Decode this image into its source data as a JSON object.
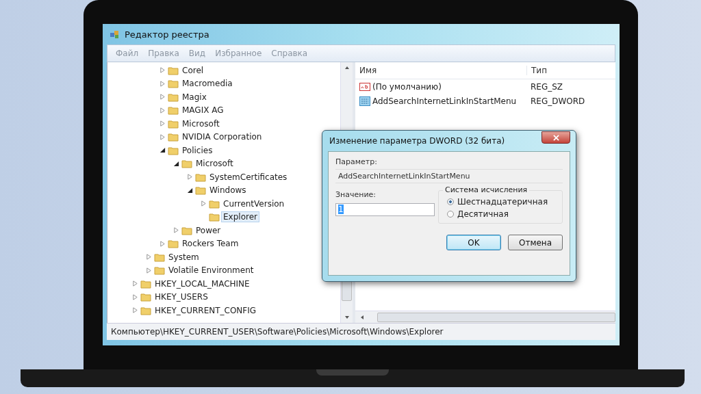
{
  "window": {
    "title": "Редактор реестра"
  },
  "menu": [
    "Файл",
    "Правка",
    "Вид",
    "Избранное",
    "Справка"
  ],
  "tree": [
    {
      "children": [
        {
          "children": [
            {
              "label": "Corel",
              "expandable": true,
              "expanded": false,
              "selected": false
            },
            {
              "label": "Macromedia",
              "expandable": true,
              "expanded": false,
              "selected": false
            },
            {
              "label": "Magix",
              "expandable": true,
              "expanded": false,
              "selected": false
            },
            {
              "label": "MAGIX AG",
              "expandable": true,
              "expanded": false,
              "selected": false
            },
            {
              "label": "Microsoft",
              "expandable": true,
              "expanded": false,
              "selected": false
            },
            {
              "label": "NVIDIA Corporation",
              "expandable": true,
              "expanded": false,
              "selected": false
            },
            {
              "label": "Policies",
              "expandable": true,
              "expanded": true,
              "selected": false,
              "children": [
                {
                  "label": "Microsoft",
                  "expandable": true,
                  "expanded": true,
                  "selected": false,
                  "children": [
                    {
                      "label": "SystemCertificates",
                      "expandable": true,
                      "expanded": false,
                      "selected": false
                    },
                    {
                      "label": "Windows",
                      "expandable": true,
                      "expanded": true,
                      "selected": false,
                      "children": [
                        {
                          "label": "CurrentVersion",
                          "expandable": true,
                          "expanded": false,
                          "selected": false
                        },
                        {
                          "label": "Explorer",
                          "expandable": false,
                          "selected": true
                        }
                      ]
                    }
                  ]
                },
                {
                  "label": "Power",
                  "expandable": true,
                  "expanded": false,
                  "selected": false
                }
              ]
            },
            {
              "label": "Rockers Team",
              "expandable": true,
              "expanded": false,
              "selected": false
            }
          ]
        },
        {
          "label": "System",
          "expandable": true,
          "expanded": false,
          "selected": false
        },
        {
          "label": "Volatile Environment",
          "expandable": true,
          "expanded": false,
          "selected": false
        }
      ]
    },
    {
      "label": "HKEY_LOCAL_MACHINE",
      "expandable": true,
      "expanded": false,
      "selected": false
    },
    {
      "label": "HKEY_USERS",
      "expandable": true,
      "expanded": false,
      "selected": false
    },
    {
      "label": "HKEY_CURRENT_CONFIG",
      "expandable": true,
      "expanded": false,
      "selected": false
    }
  ],
  "values": {
    "columns": [
      "Имя",
      "Тип"
    ],
    "rows": [
      {
        "kind": "string",
        "name": "(По умолчанию)",
        "type": "REG_SZ"
      },
      {
        "kind": "binary",
        "name": "AddSearchInternetLinkInStartMenu",
        "type": "REG_DWORD"
      }
    ]
  },
  "dialog": {
    "title": "Изменение параметра DWORD (32 бита)",
    "parameter_label": "Параметр:",
    "parameter_value": "AddSearchInternetLinkInStartMenu",
    "value_label": "Значение:",
    "value": "1",
    "base_label": "Система исчисления",
    "bases": [
      {
        "label": "Шестнадцатеричная",
        "selected": true
      },
      {
        "label": "Десятичная",
        "selected": false
      }
    ],
    "buttons": [
      {
        "label": "OK",
        "kind": "default"
      },
      {
        "label": "Отмена",
        "kind": "normal"
      }
    ]
  },
  "status_bar": "Компьютер\\HKEY_CURRENT_USER\\Software\\Policies\\Microsoft\\Windows\\Explorer"
}
